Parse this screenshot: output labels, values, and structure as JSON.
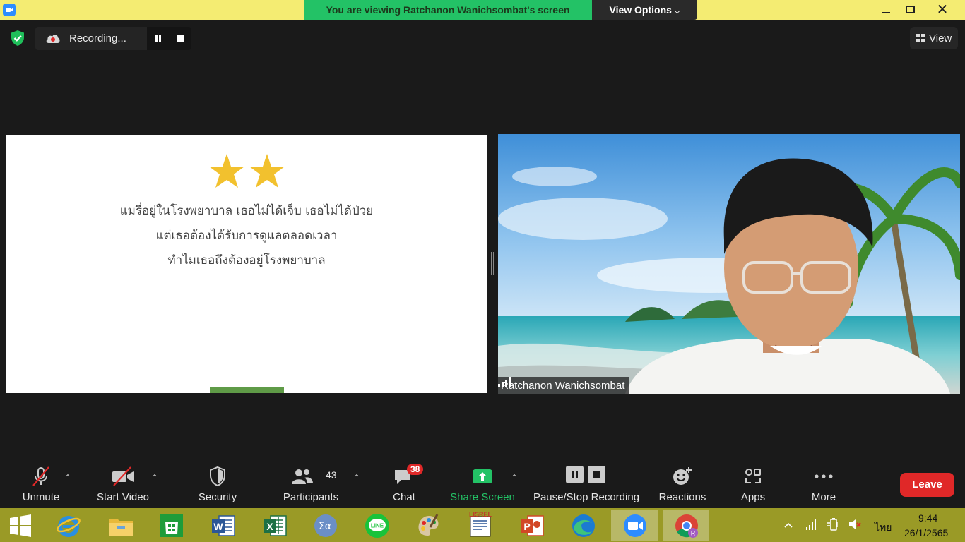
{
  "window": {
    "share_banner": "You are viewing Ratchanon Wanichsombat's screen",
    "view_options": "View Options",
    "view_options_icon": "chevron-down-icon",
    "controls": [
      "minimize-icon",
      "maximize-icon",
      "close-icon"
    ]
  },
  "topbar": {
    "recording_text": "Recording...",
    "view_label": "View"
  },
  "slide": {
    "line1": "แมรี่อยู่ในโรงพยาบาล เธอไม่ได้เจ็บ เธอไม่ได้ป่วย",
    "line2": "แต่เธอต้องได้รับการดูแลตลอดเวลา",
    "line3": "ทำไมเธอถึงต้องอยู่โรงพยาบาล",
    "star_color": "#f2c12e",
    "bar_color": "#5f9b47"
  },
  "video": {
    "participant_name": "Ratchanon Wanichsombat"
  },
  "toolbar": {
    "unmute": "Unmute",
    "start_video": "Start Video",
    "security": "Security",
    "participants": "Participants",
    "participants_count": "43",
    "chat": "Chat",
    "chat_badge": "38",
    "share_screen": "Share Screen",
    "pause_stop_recording": "Pause/Stop Recording",
    "reactions": "Reactions",
    "apps": "Apps",
    "more": "More",
    "leave": "Leave",
    "accent_green": "#23c266",
    "leave_color": "#e02828"
  },
  "taskbar": {
    "apps": [
      "windows-start-icon",
      "internet-explorer-icon",
      "file-explorer-icon",
      "microsoft-store-icon",
      "word-icon",
      "excel-icon",
      "math-input-icon",
      "line-icon",
      "paint-icon",
      "lisrel-icon",
      "powerpoint-icon",
      "edge-icon",
      "zoom-icon",
      "chrome-icon"
    ],
    "language": "ไทย",
    "time": "9:44",
    "date": "26/1/2565"
  }
}
